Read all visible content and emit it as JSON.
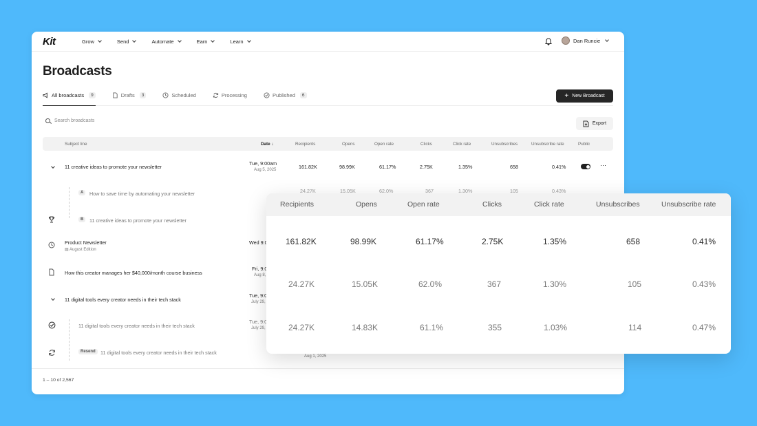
{
  "nav": {
    "logo": "Kit",
    "items": [
      "Grow",
      "Send",
      "Automate",
      "Earn",
      "Learn"
    ],
    "user": "Dan Runcie"
  },
  "page": {
    "title": "Broadcasts"
  },
  "tabs": [
    {
      "label": "All broadcasts",
      "count": "9"
    },
    {
      "label": "Drafts",
      "count": "3"
    },
    {
      "label": "Scheduled",
      "count": ""
    },
    {
      "label": "Processing",
      "count": ""
    },
    {
      "label": "Published",
      "count": "6"
    }
  ],
  "actions": {
    "new_broadcast": "New Broadcast",
    "export": "Export"
  },
  "search": {
    "placeholder": "Search broadcasts"
  },
  "table": {
    "headers": [
      "Subject line",
      "Date",
      "Recipients",
      "Opens",
      "Open rate",
      "Clicks",
      "Click rate",
      "Unsubscribes",
      "Unsubscribe rate",
      "Public"
    ],
    "rows": [
      {
        "subject": "11 creative ideas to promote your newsletter",
        "date": "Tue, 9:00am",
        "date2": "Aug 5, 2025",
        "recipients": "161.82K",
        "opens": "98.99K",
        "open_rate": "61.17%",
        "clicks": "2.75K",
        "click_rate": "1.35%",
        "unsubs": "658",
        "unsub_rate": "0.41%"
      },
      {
        "variant": "A",
        "subject": "How to save time by automating your newsletter",
        "recipients": "24.27K",
        "opens": "15.05K",
        "open_rate": "62.0%",
        "clicks": "367",
        "click_rate": "1.30%",
        "unsubs": "105",
        "unsub_rate": "0.43%"
      },
      {
        "variant": "B",
        "subject": "11 creative ideas to promote your newsletter"
      },
      {
        "subject": "Product Newsletter",
        "sub": "August Edition",
        "date": "Wed 9:0"
      },
      {
        "subject": "How this creator manages her $40,000/month course business",
        "date": "Fri, 9:0",
        "date2": "Aug 8,"
      },
      {
        "subject": "11 digital tools every creator needs in their tech stack",
        "date": "Tue, 9:0",
        "date2": "July 29,"
      },
      {
        "subject": "11 digital tools every creator needs in their tech stack",
        "date": "Tue, 9:0",
        "date2": "July 29,"
      },
      {
        "badge": "Resend",
        "subject": "11 digital tools every creator needs in their tech stack",
        "date2": "Aug 1, 2025"
      }
    ]
  },
  "footer": {
    "pagination": "1 – 10 of 2,567"
  },
  "card": {
    "headers": [
      "Recipients",
      "Opens",
      "Open rate",
      "Clicks",
      "Click rate",
      "Unsubscribes",
      "Unsubscribe rate"
    ],
    "rows": [
      [
        "161.82K",
        "98.99K",
        "61.17%",
        "2.75K",
        "1.35%",
        "658",
        "0.41%"
      ],
      [
        "24.27K",
        "15.05K",
        "62.0%",
        "367",
        "1.30%",
        "105",
        "0.43%"
      ],
      [
        "24.27K",
        "14.83K",
        "61.1%",
        "355",
        "1.03%",
        "114",
        "0.47%"
      ]
    ]
  }
}
